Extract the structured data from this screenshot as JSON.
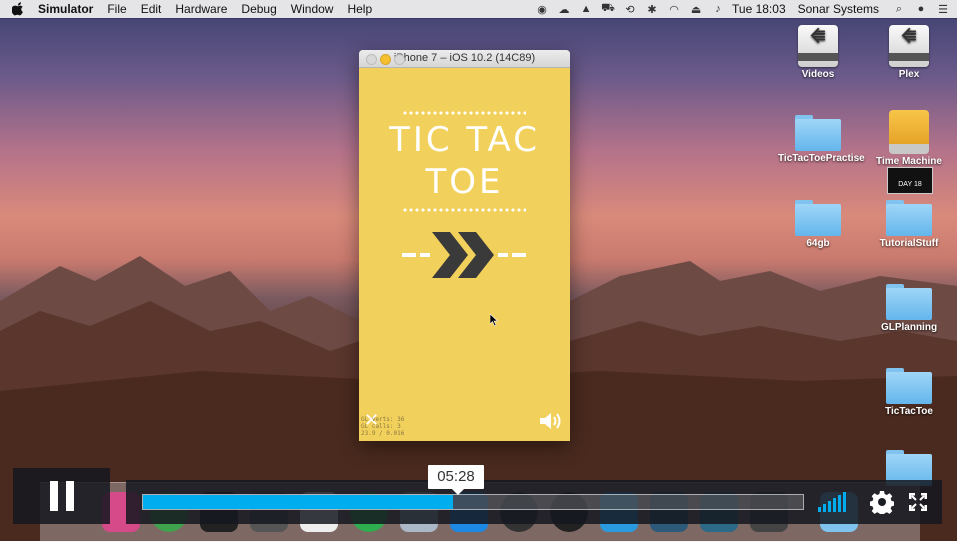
{
  "menubar": {
    "app_name": "Simulator",
    "menus": [
      "File",
      "Edit",
      "Hardware",
      "Debug",
      "Window",
      "Help"
    ],
    "clock": "Tue 18:03",
    "user": "Sonar Systems"
  },
  "simulator": {
    "window_title": "iPhone 7 – iOS 10.2 (14C89)",
    "game_title_line1": "TIC TAC",
    "game_title_line2": "TOE",
    "stats": [
      "GL verts:  36",
      "GL calls:  3",
      "23.9 / 0.016"
    ]
  },
  "desktop_icons": [
    {
      "label": "Videos",
      "kind": "drive"
    },
    {
      "label": "Plex",
      "kind": "drive"
    },
    {
      "label": "TicTacToePractise",
      "kind": "folder"
    },
    {
      "label": "Time Machine",
      "kind": "timemachine"
    },
    {
      "label": "64gb",
      "kind": "folder"
    },
    {
      "label": "TutorialStuff",
      "kind": "folder"
    },
    {
      "label": "GLPlanning",
      "kind": "folder"
    },
    {
      "label": "TicTacToe",
      "kind": "folder"
    }
  ],
  "day_badge": "DAY 18",
  "player": {
    "current_time": "05:28",
    "progress_fraction": 0.47,
    "accent": "#00adef"
  }
}
